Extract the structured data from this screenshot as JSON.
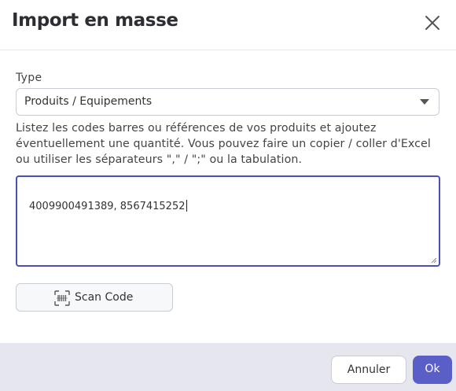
{
  "dialog": {
    "title": "Import en masse",
    "close_icon": "close-icon"
  },
  "form": {
    "type_label": "Type",
    "type_value": "Produits / Equipements",
    "help_text": "Listez les codes barres ou références de vos produits et ajoutez éventuellement une quantité. Vous pouvez faire un copier / coller d'Excel ou utiliser les séparateurs \",\" / \";\" ou la tabulation.",
    "textarea_value": "4009900491389, 8567415252",
    "scan_button_label": "Scan Code",
    "scan_icon": "barcode-scan-icon"
  },
  "footer": {
    "cancel_label": "Annuler",
    "ok_label": "Ok"
  },
  "colors": {
    "primary": "#5a5fc7",
    "focus_border": "#4b51b4",
    "footer_bg": "#e6e7ee"
  }
}
